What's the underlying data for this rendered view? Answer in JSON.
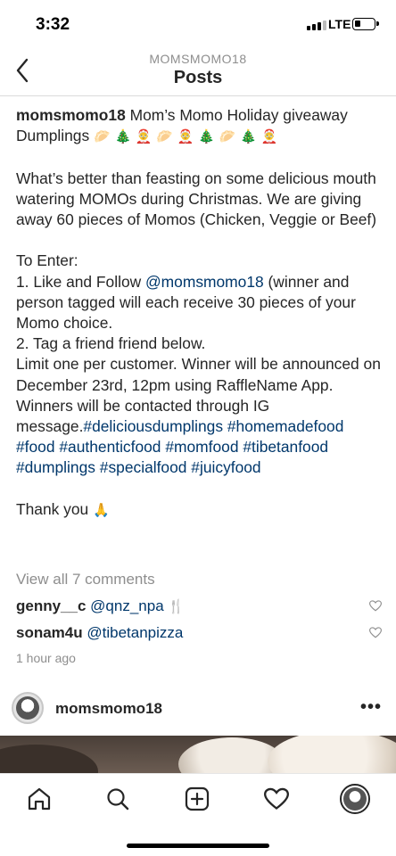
{
  "status_bar": {
    "time": "3:32",
    "network": "LTE"
  },
  "header": {
    "username": "MOMSMOMO18",
    "title": "Posts"
  },
  "caption": {
    "username": "momsmomo18",
    "title_text": "Mom’s Momo Holiday giveaway Dumplings",
    "title_emojis": "🥟 🎄 🤶 🥟 🤶 🎄 🥟 🎄 🤶",
    "para1": "What’s better than feasting on some delicious mouth watering MOMOs during Christmas. We are giving away 60 pieces of Momos (Chicken, Veggie or Beef)",
    "to_enter": "To Enter:",
    "step1_prefix": "1. Like and Follow ",
    "step1_mention": "@momsmomo18",
    "step1_suffix": " (winner and person tagged will each receive 30 pieces of your Momo choice.",
    "step2": "2. Tag a friend friend below.",
    "limit_text": "Limit one per customer. Winner will be announced on December 23rd, 12pm using RaffleName App. Winners will be contacted through IG message.",
    "hashtags": [
      "#deliciousdumplings",
      "#homemadefood",
      "#food",
      "#authenticfood",
      "#momfood",
      "#tibetanfood",
      "#dumplings",
      "#specialfood",
      "#juicyfood"
    ],
    "thanks": "Thank you",
    "thanks_emoji": "🙏"
  },
  "comments": {
    "view_all": "View all 7 comments",
    "items": [
      {
        "user": "genny__c",
        "mention": "@qnz_npa",
        "emoji": "🍴"
      },
      {
        "user": "sonam4u",
        "mention": "@tibetanpizza",
        "emoji": ""
      }
    ],
    "time_ago": "1 hour ago"
  },
  "next_post": {
    "username": "momsmomo18",
    "more": "•••"
  },
  "icons": {
    "back": "chevron-left-icon",
    "home": "home-icon",
    "search": "search-icon",
    "add": "add-post-icon",
    "activity": "heart-icon",
    "profile": "profile-avatar-icon"
  },
  "colors": {
    "text": "#262626",
    "secondary": "#8e8e8e",
    "link": "#00376b",
    "divider": "#dbdbdb"
  }
}
